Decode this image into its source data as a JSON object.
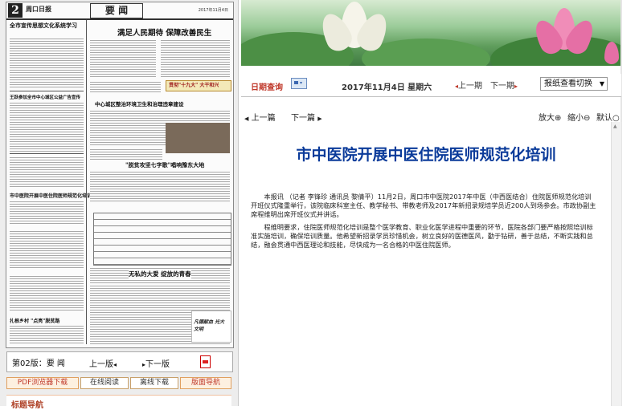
{
  "newspaper": {
    "page_number": "2",
    "masthead": "周口日报",
    "section": "要 闻",
    "date_small": "2017年11月4日",
    "headlines": [
      "全市宣传思想文化系统学习",
      "满足人民期待 保障改善民生",
      "王跃参加全市中心城区公益广告宣传",
      "中心城区整治环境卫生和治理违章建设",
      "市中医院开展中医住院医师规范化培训",
      "\"脱贫攻坚七字歌\"唱响豫东大地",
      "无私的大爱 绽放的青春",
      "扎根乡村 \"点亮\"脱贫路"
    ],
    "banner_text": "贯彻\"十九大\" 大干和兴",
    "stamp_text": "凡德献血 光大文明"
  },
  "nav": {
    "edition_label": "第02版：要 闻",
    "prev_edition": "上一版",
    "next_edition": "下一版"
  },
  "buttons": {
    "pdf_download": "PDF浏览器下载",
    "online_read": "在线阅读",
    "offline_download": "离线下载",
    "layout_nav": "版面导航"
  },
  "layout_nav_title": "标题导航",
  "toolbar": {
    "date_query": "日期查询",
    "date_select_icon": "calendar-icon",
    "current_date": "2017年11月4日 星期六",
    "prev_issue": "上一期",
    "next_issue": "下一期",
    "switch_label": "报纸查看切换",
    "accent": "#c0392b"
  },
  "pager": {
    "prev_article": "上一篇",
    "next_article": "下一篇",
    "zoom_in": "放大",
    "zoom_out": "缩小",
    "default": "默认"
  },
  "article": {
    "title": "市中医院开展中医住院医师规范化培训",
    "paragraphs": [
      "本报讯 （记者 李锋珍 通讯员 黎倩平）11月2日，周口市中医院2017年中医（中西医结合）住院医师规范化培训开班仪式隆重举行，该院临床科室主任、教学秘书、带教老师及2017年新招录规培学员近200人到场参会。市政协副主席程维明出席开班仪式并讲话。",
      "程维明要求，住院医师规范化培训是整个医学教育、职业化医学进程中重要的环节，医院各部门要严格按照培训标准实施培训，确保培训质量。他希望新招录学员珍惜机会，树立良好的医德医风，勤于钻研，善于总结，不断实践和总结，融会贯通中西医理论和技能，尽快成为一名合格的中医住院医师。"
    ],
    "title_color": "#0b3b9a"
  }
}
